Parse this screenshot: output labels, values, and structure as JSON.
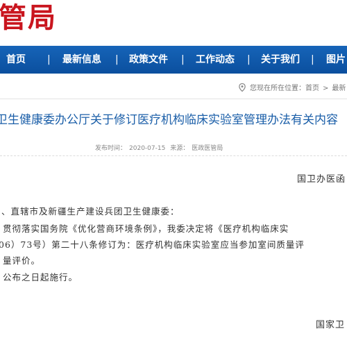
{
  "header": {
    "site_title": "管局",
    "brand_color": "#c9151e"
  },
  "nav": {
    "background": "#0b4f9e",
    "items": [
      {
        "label": "首页"
      },
      {
        "label": "最新信息"
      },
      {
        "label": "政策文件"
      },
      {
        "label": "工作动态"
      },
      {
        "label": "关于我们"
      },
      {
        "label": "图片"
      }
    ],
    "separator": "|"
  },
  "breadcrumb": {
    "icon": "location-pin-icon",
    "prefix": "您现在所在位置：",
    "home": "首页",
    "separator": ">",
    "current": "最新"
  },
  "article": {
    "title": "卫生健康委办公厅关于修订医疗机构临床实验室管理办法有关内容",
    "title_color": "#1a5ea8",
    "publish_label": "发布时间：",
    "publish_date": "2020-07-15",
    "source_label": "来源：",
    "source": "医政医管局",
    "doc_number": "国卫办医函",
    "body": [
      "、直辖市及新疆生产建设兵团卫生健康委：",
      "贯彻落实国务院《优化营商环境条例》，我委决定将《医疗机构临床实",
      "06）73号）第二十八条修订为：医疗机构临床实验室应当参加室间质量评",
      "量评价。",
      "公布之日起施行。"
    ],
    "signature": "国家卫"
  }
}
